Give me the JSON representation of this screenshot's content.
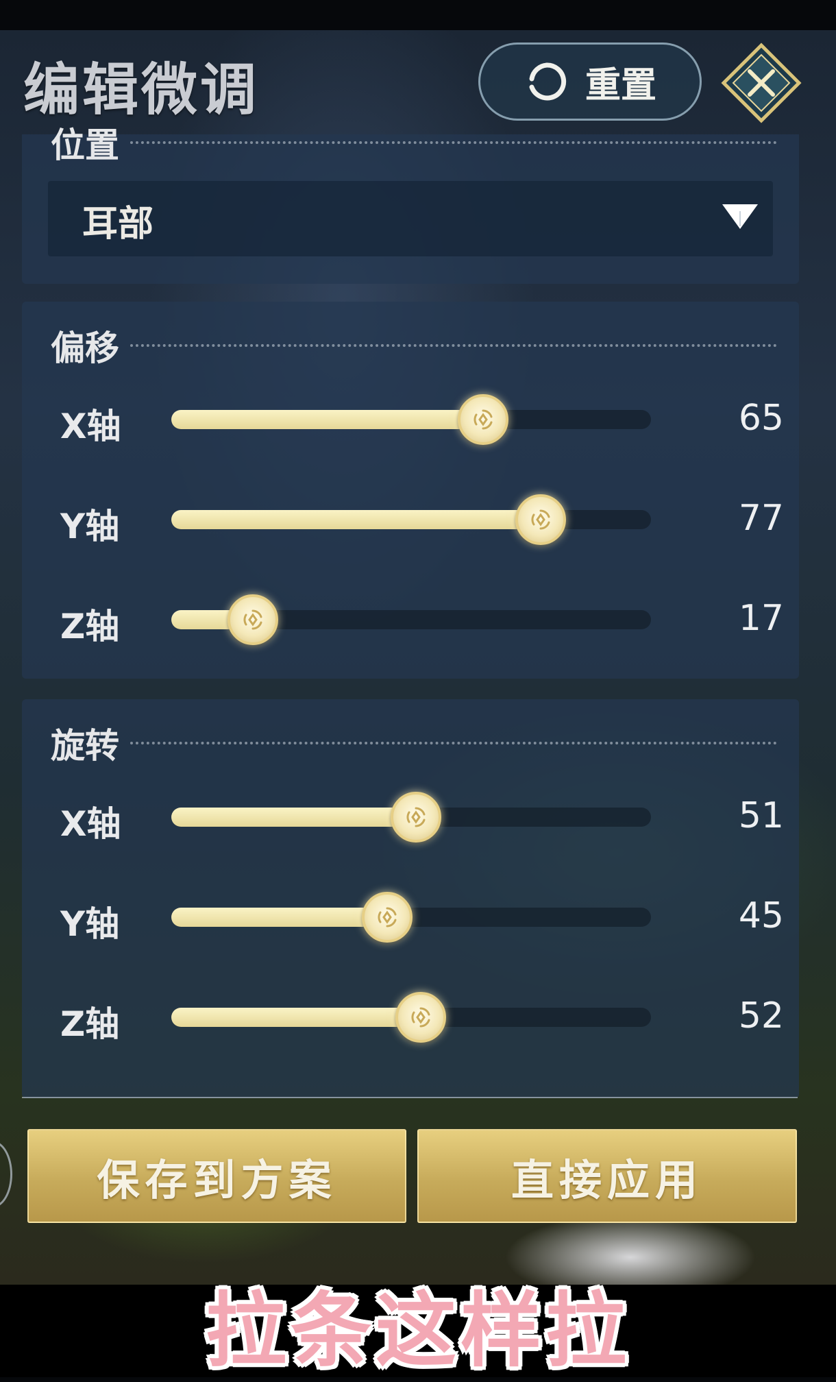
{
  "header": {
    "title": "编辑微调",
    "reset_label": "重置"
  },
  "position_section": {
    "label": "位置",
    "selected": "耳部"
  },
  "offset_section": {
    "label": "偏移",
    "sliders": [
      {
        "axis": "X轴",
        "value": 65
      },
      {
        "axis": "Y轴",
        "value": 77
      },
      {
        "axis": "Z轴",
        "value": 17
      }
    ]
  },
  "rotation_section": {
    "label": "旋转",
    "sliders": [
      {
        "axis": "X轴",
        "value": 51
      },
      {
        "axis": "Y轴",
        "value": 45
      },
      {
        "axis": "Z轴",
        "value": 52
      }
    ]
  },
  "actions": {
    "save_label": "保存到方案",
    "apply_label": "直接应用"
  },
  "caption": "拉条这样拉",
  "colors": {
    "accent_gold": "#d9bf6c",
    "slider_fill": "#f2e8b4",
    "panel_bg": "#243850",
    "caption_pink": "#f3a8b4"
  },
  "icons": {
    "reset": "refresh-icon",
    "close": "close-icon",
    "dropdown": "triangle-down-icon"
  }
}
